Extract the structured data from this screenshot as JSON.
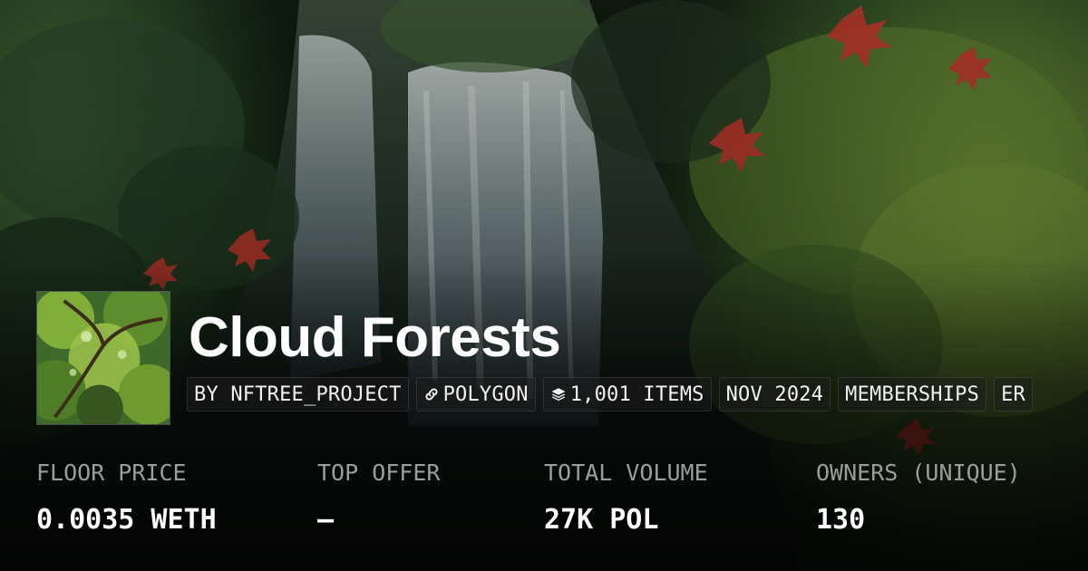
{
  "collection": {
    "title": "Cloud Forests"
  },
  "tags": [
    {
      "label": "BY NFTREE_PROJECT",
      "icon": ""
    },
    {
      "label": "POLYGON",
      "icon": "link-icon"
    },
    {
      "label": "1,001 ITEMS",
      "icon": "layers-icon"
    },
    {
      "label": "NOV 2024",
      "icon": ""
    },
    {
      "label": "MEMBERSHIPS",
      "icon": ""
    },
    {
      "label": "ER",
      "icon": ""
    }
  ],
  "stats": [
    {
      "label": "FLOOR PRICE",
      "value": "0.0035 WETH"
    },
    {
      "label": "TOP OFFER",
      "value": "–"
    },
    {
      "label": "TOTAL VOLUME",
      "value": "27K POL"
    },
    {
      "label": "OWNERS (UNIQUE)",
      "value": "130"
    }
  ],
  "colors": {
    "text": "#ffffff",
    "muted": "#9a9e9c",
    "tag_bg": "#1e1e1e"
  }
}
